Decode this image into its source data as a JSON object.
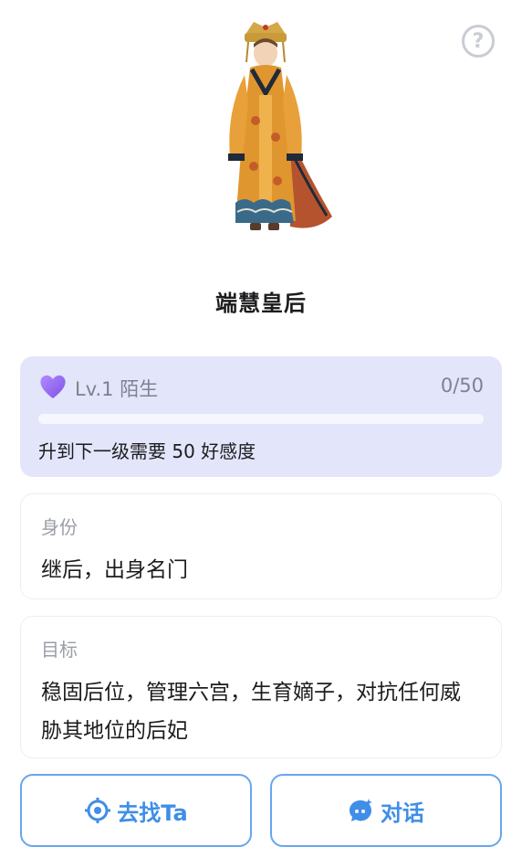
{
  "help": {
    "icon": "help-circle-icon",
    "glyph": "?"
  },
  "character": {
    "name": "端慧皇后",
    "portrait_icon": "empress-portrait"
  },
  "level": {
    "icon": "purple-heart-icon",
    "label": "Lv.1 陌生",
    "progress_text": "0/50",
    "progress_fraction": 0,
    "hint": "升到下一级需要 50 好感度",
    "color": "#9a8cf2"
  },
  "identity": {
    "label": "身份",
    "value": "继后，出身名门"
  },
  "goal": {
    "label": "目标",
    "value": "稳固后位，管理六宫，生育嫡子，对抗任何威胁其地位的后妃"
  },
  "actions": {
    "find": {
      "icon": "target-icon",
      "label": "去找Ta"
    },
    "chat": {
      "icon": "chat-bubble-icon",
      "label": "对话"
    }
  },
  "colors": {
    "accent": "#3f8ee8",
    "card_bg": "#e3e5fb",
    "heart": "#9a6cf0"
  }
}
